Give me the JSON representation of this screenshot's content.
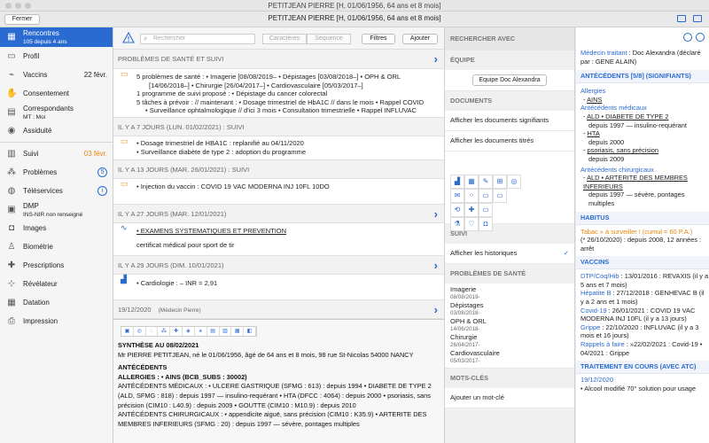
{
  "window": {
    "title": "PETITJEAN PIERRE [H, 01/06/1956, 64 ans et 8 mois]"
  },
  "toolbar": {
    "close_label": "Fermer",
    "title": "PETITJEAN PIERRE [H, 01/06/1956, 64 ans et 8 mois]"
  },
  "sidebar": {
    "rencontres": {
      "label": "Rencontres",
      "sub": "105 depuis 4 ans"
    },
    "profil": "Profil",
    "vaccins": {
      "label": "Vaccins",
      "date": "22 févr."
    },
    "consentement": "Consentement",
    "correspondants": {
      "label": "Correspondants",
      "sub": "MT : Moi"
    },
    "assiduite": "Assiduité",
    "suivi": {
      "label": "Suivi",
      "date": "03 févr."
    },
    "problemes": {
      "label": "Problèmes",
      "count": "5"
    },
    "teleservices": "Téléservices",
    "dmp": {
      "label": "DMP",
      "sub": "INS-NIR non renseigné"
    },
    "images": "Images",
    "biometrie": "Biométrie",
    "prescriptions": "Prescriptions",
    "revelateur": "Révélateur",
    "datation": "Datation",
    "impression": "Impression"
  },
  "search": {
    "placeholder": "Rechercher",
    "caracteres": "Caractères",
    "sequence": "Séquence",
    "filtres": "Filtres",
    "ajouter": "Ajouter"
  },
  "timeline": {
    "problems_header": "PROBLÈMES DE SANTÉ ET SUIVI",
    "problems_lines": [
      "5 problèmes de santé : • Imagerie [08/08/2019– • Dépistages [03/08/2018–] • OPH & ORL",
      "[14/06/2018–] • Chirurgie [26/04/2017–] • Cardiovasculaire [05/03/2017–]",
      "1 programme de suivi proposé : • Dépistage du cancer colorectal",
      "5 tâches à prévoir : // maintenant : • Dosage trimestriel de HbA1C // dans le mois • Rappel COVID",
      "• Surveillance ophtalmologique // d'ici 3 mois • Consultation trimestrielle • Rappel INFLUVAC"
    ],
    "g1_header": "IL Y A 7 JOURS (LUN. 01/02/2021) : SUIVI",
    "g1_lines": [
      "• Dosage trimestriel de HBA1C : replanifié au 04/11/2020",
      "• Surveillance diabète de type 2 : adoption du programme"
    ],
    "g2_header": "IL Y A 13 JOURS (MAR. 26/01/2021) : SUIVI",
    "g2_lines": [
      "• Injection du vaccin : COVID 19 VAC MODERNA INJ 10FL 10DO"
    ],
    "g3_header": "IL Y A 27 JOURS (MAR. 12/01/2021)",
    "g3_lines": [
      "• EXAMENS SYSTEMATIQUES ET PREVENTION",
      "certificat médical pour sport de tir"
    ],
    "g4_header": "IL Y A 29 JOURS (DIM. 10/01/2021)",
    "g4_lines": [
      "• Cardiologie : – INR = 2,91"
    ],
    "g5_header": "19/12/2020",
    "g5_sub": "(Médecin Pierre)"
  },
  "document": {
    "title": "SYNTHÈSE AU 08/02/2021",
    "line1": "Mr PIERRE PETITJEAN, né le 01/06/1956, âgé de 64 ans et 8 mois, 98 rue St-Nicolas 54000 NANCY",
    "antecedents": "ANTÉCÉDENTS",
    "allergies": "ALLERGIES : • AINS (BCB_SUBS : 30002)",
    "medicaux": "ANTÉCÉDENTS MÉDICAUX : • ULCERE GASTRIQUE (SFMG : 613) : depuis 1994 • DIABETE DE TYPE 2",
    "medicaux2": "(ALD, SFMG : 818) : depuis 1997 — insulino-requérant • HTA (DFCC : 4064) : depuis 2000 • psoriasis, sans",
    "medicaux3": "précision (CIM10 : L40.9) : depuis 2009 • GOUTTE (CIM10 : M10.9) : depuis 2010",
    "chirurgicaux": "ANTÉCÉDENTS CHIRURGICAUX : • appendicite aiguë, sans précision (CIM10 : K35.9) • ARTERITE DES",
    "chirurgicaux2": "MEMBRES INFERIEURS (SFMG : 20) : depuis 1997 — sévère, pontages multiples"
  },
  "rpanel": {
    "rechercher_avec": "RECHERCHER AVEC",
    "equipe": "ÉQUIPE",
    "equipe_btn": "Equipe Doc Alexandra",
    "documents": "DOCUMENTS",
    "doc_signifiants": "Afficher les documents signifiants",
    "doc_titres": "Afficher les documents titrés",
    "suivi": "SUIVI",
    "historiques": "Afficher les historiques",
    "problemes": "PROBLÈMES DE SANTÉ",
    "prob_items": [
      {
        "name": "Imagerie",
        "date": "08/08/2019-"
      },
      {
        "name": "Dépistages",
        "date": "03/08/2018-"
      },
      {
        "name": "OPH & ORL",
        "date": "14/06/2018-"
      },
      {
        "name": "Chirurgie",
        "date": "26/04/2017-"
      },
      {
        "name": "Cardiovasculaire",
        "date": "05/03/2017-"
      }
    ],
    "mots_cles": "MOTS-CLÉS",
    "ajouter_mot": "Ajouter un mot-clé"
  },
  "far": {
    "medecin_label": "Médecin traitant",
    "medecin_value": ": Doc Alexandra (déclaré par : GENE ALAIN)",
    "antecedents_head": "ANTÉCÉDENTS [5/8] (SIGNIFIANTS)",
    "allergies_label": "Allergies",
    "allergie_item": "AINS",
    "medicaux_label": "Antécédents médicaux",
    "ald": "ALD • DIABETE DE TYPE 2",
    "ald_since": "depuis 1997 — insulino-requérant",
    "hta": "HTA",
    "hta_since": "depuis 2000",
    "psoriasis": "psoriasis, sans précision",
    "psoriasis_since": "depuis 2009",
    "chir_label": "Antécédents chirurgicaux",
    "arterite": "ALD • ARTERITE DES MEMBRES INFERIEURS",
    "arterite_since": "depuis 1997 — sévère, pontages multiples",
    "habitus_head": "HABITUS",
    "tabac": "Tabac » à surveiller ! (cumul = 60 P.A.)",
    "tabac2": "(* 26/10/2020) : depuis 2008, 12 années : arrêt",
    "vaccins_head": "VACCINS",
    "vac1_label": "DTP/Coq/Hib",
    "vac1_value": ": 13/01/2016 : REVAXIS (il y a 5 ans et 7 mois)",
    "vac2_label": "Hépatite B",
    "vac2_value": ": 27/12/2018 : GENHEVAC B (il y a 2 ans et 1 mois)",
    "vac3_label": "Covid-19",
    "vac3_value": ": 26/01/2021 : COVID 19 VAC MODERNA INJ 10FL (il y a 13 jours)",
    "vac4_label": "Grippe",
    "vac4_value": ": 22/10/2020 : INFLUVAC (il y a 3 mois et 16 jours)",
    "vac5_label": "Rappels à faire",
    "vac5_value": ": »22/02/2021 : Covid-19 • 04/2021 : Grippe",
    "traitement_head": "TRAITEMENT EN COURS (AVEC ATC)",
    "trait_date": "19/12/2020",
    "trait_item": "• Alcool modifié 70° solution pour usage"
  }
}
